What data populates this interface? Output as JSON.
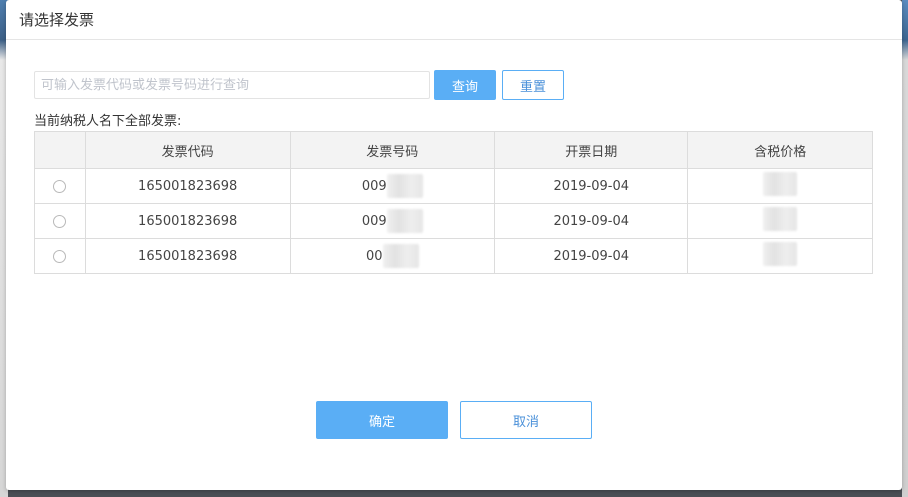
{
  "dialog": {
    "title": "请选择发票"
  },
  "search": {
    "placeholder": "可输入发票代码或发票号码进行查询",
    "value": "",
    "query_label": "查询",
    "reset_label": "重置"
  },
  "list": {
    "caption": "当前纳税人名下全部发票:",
    "headers": {
      "select": "",
      "invoice_code": "发票代码",
      "invoice_number": "发票号码",
      "issue_date": "开票日期",
      "price_incl_tax": "含税价格"
    },
    "rows": [
      {
        "selected": false,
        "invoice_code": "165001823698",
        "invoice_number_visible": "009",
        "issue_date": "2019-09-04"
      },
      {
        "selected": false,
        "invoice_code": "165001823698",
        "invoice_number_visible": "009",
        "issue_date": "2019-09-04"
      },
      {
        "selected": false,
        "invoice_code": "165001823698",
        "invoice_number_visible": "00",
        "issue_date": "2019-09-04"
      }
    ]
  },
  "footer": {
    "confirm_label": "确定",
    "cancel_label": "取消"
  },
  "colors": {
    "primary": "#5aaef5",
    "primary_text": "#4a90d9",
    "header_bg": "#f3f3f3",
    "border": "#dcdcdc"
  }
}
